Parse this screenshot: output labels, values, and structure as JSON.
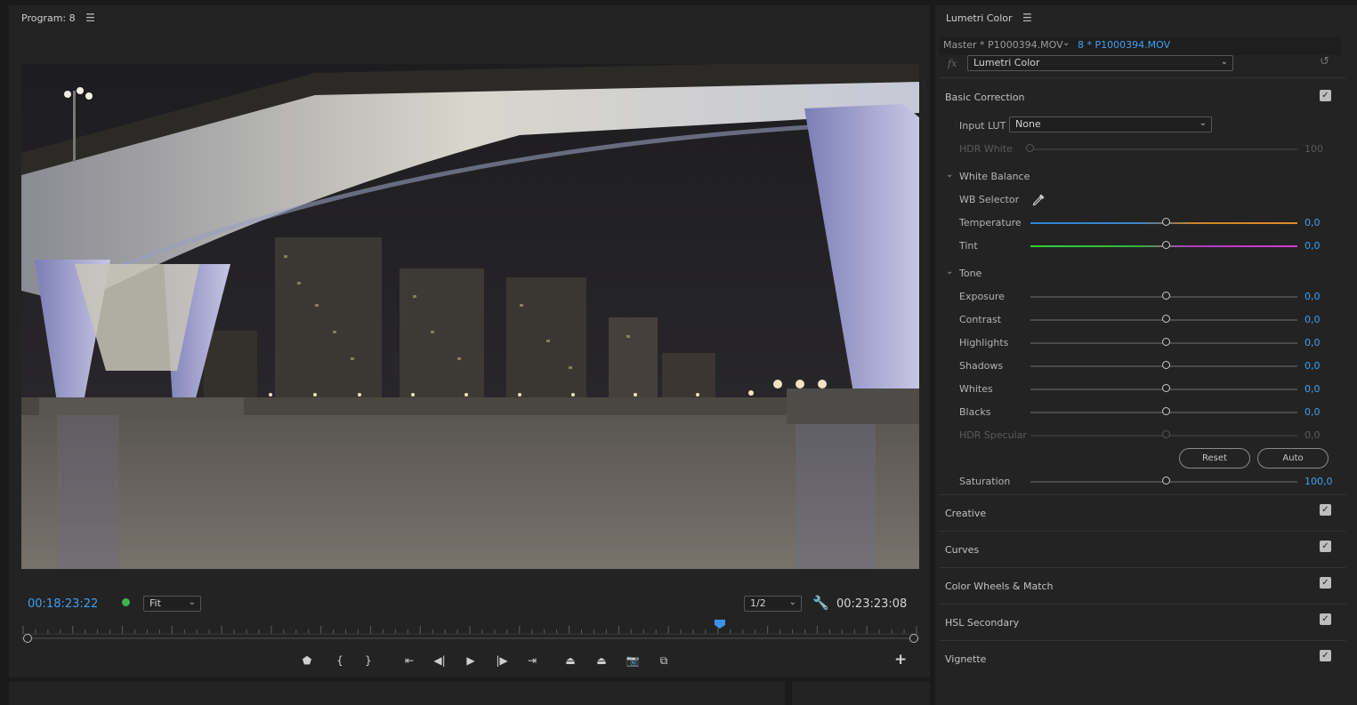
{
  "program": {
    "title": "Program: 8",
    "timecode_current": "00:18:23:22",
    "zoom": "Fit",
    "resolution": "1/2",
    "timecode_duration": "00:23:23:08",
    "playhead_fraction": 0.778,
    "transport": [
      {
        "name": "add-marker-button",
        "glyph": "⬟"
      },
      {
        "name": "mark-in-button",
        "glyph": "{"
      },
      {
        "name": "mark-out-button",
        "glyph": "}"
      },
      {
        "name": "go-to-in-button",
        "glyph": "⇤"
      },
      {
        "name": "step-back-button",
        "glyph": "◀|"
      },
      {
        "name": "play-button",
        "glyph": "▶"
      },
      {
        "name": "step-forward-button",
        "glyph": "|▶"
      },
      {
        "name": "go-to-out-button",
        "glyph": "⇥"
      },
      {
        "name": "lift-button",
        "glyph": "⏏"
      },
      {
        "name": "extract-button",
        "glyph": "⏏"
      },
      {
        "name": "export-frame-button",
        "glyph": "📷"
      },
      {
        "name": "comparison-view-button",
        "glyph": "⧉"
      }
    ],
    "plus_label": "+"
  },
  "lumetri": {
    "title": "Lumetri Color",
    "master_label": "Master * P1000394.MOV",
    "clip_label": "8 * P1000394.MOV",
    "fx": "fx",
    "effect": "Lumetri Color",
    "basic": {
      "title": "Basic Correction",
      "input_lut_label": "Input LUT",
      "input_lut_value": "None",
      "hdr_white": {
        "label": "HDR White",
        "value": "100",
        "pos": 0
      },
      "white_balance_title": "White Balance",
      "wb_selector_label": "WB Selector",
      "temperature": {
        "label": "Temperature",
        "value": "0,0",
        "pos": 0.51
      },
      "tint": {
        "label": "Tint",
        "value": "0,0",
        "pos": 0.51
      },
      "tone_title": "Tone",
      "tone": [
        {
          "label": "Exposure",
          "value": "0,0",
          "pos": 0.51
        },
        {
          "label": "Contrast",
          "value": "0,0",
          "pos": 0.51
        },
        {
          "label": "Highlights",
          "value": "0,0",
          "pos": 0.51
        },
        {
          "label": "Shadows",
          "value": "0,0",
          "pos": 0.51
        },
        {
          "label": "Whites",
          "value": "0,0",
          "pos": 0.51
        },
        {
          "label": "Blacks",
          "value": "0,0",
          "pos": 0.51
        }
      ],
      "hdr_specular": {
        "label": "HDR Specular",
        "value": "0,0",
        "pos": 0.51
      },
      "reset_label": "Reset",
      "auto_label": "Auto",
      "saturation": {
        "label": "Saturation",
        "value": "100,0",
        "pos": 0.51
      }
    },
    "sections": [
      "Creative",
      "Curves",
      "Color Wheels & Match",
      "HSL Secondary",
      "Vignette"
    ]
  }
}
